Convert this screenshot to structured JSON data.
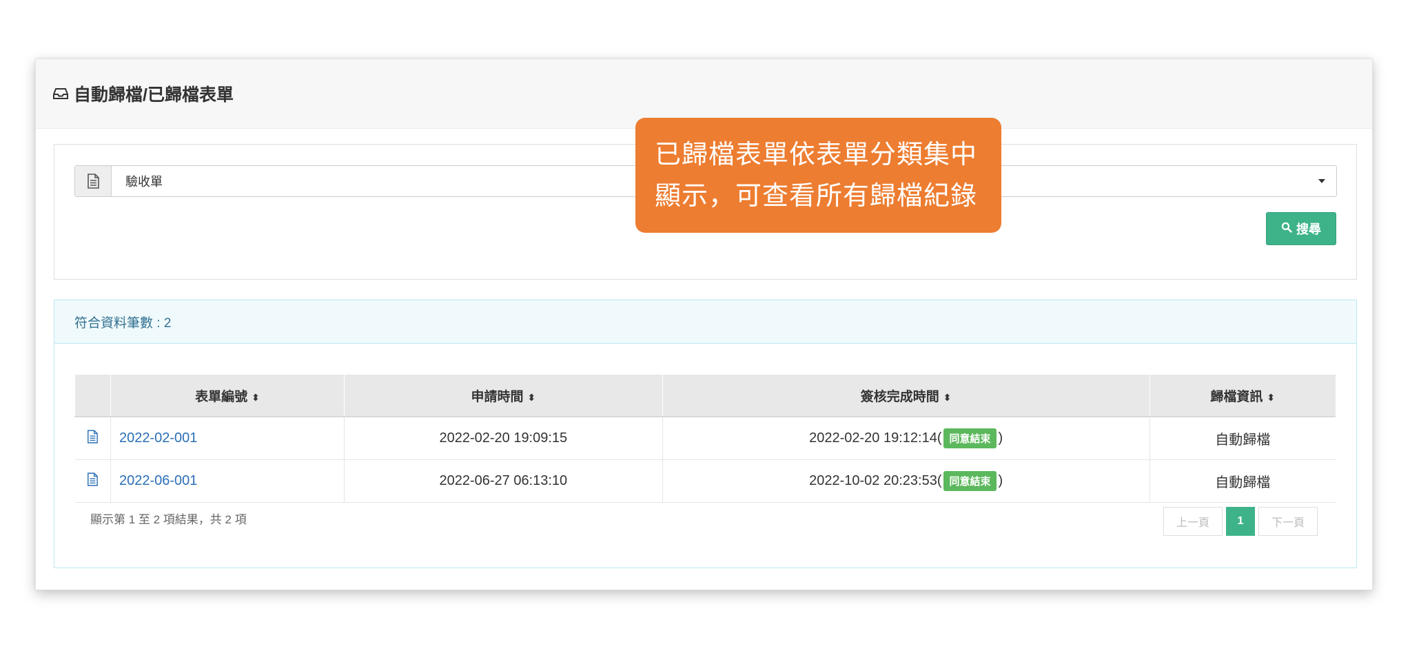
{
  "header": {
    "title": "自動歸檔/已歸檔表單"
  },
  "search": {
    "selected": "驗收單",
    "button_label": "搜尋"
  },
  "result": {
    "count_label": "符合資料筆數 : 2"
  },
  "table": {
    "columns": [
      "表單編號",
      "申請時間",
      "簽核完成時間",
      "歸檔資訊"
    ],
    "rows": [
      {
        "id": "2022-02-001",
        "apply_time": "2022-02-20 19:09:15",
        "complete_time": "2022-02-20 19:12:14(",
        "badge": "同意結束",
        "close": ")",
        "archive": "自動歸檔"
      },
      {
        "id": "2022-06-001",
        "apply_time": "2022-06-27 06:13:10",
        "complete_time": "2022-10-02 20:23:53(",
        "badge": "同意結束",
        "close": ")",
        "archive": "自動歸檔"
      }
    ]
  },
  "footer": {
    "info": "顯示第 1 至 2 項結果，共 2 項"
  },
  "pager": {
    "prev": "上一頁",
    "current": "1",
    "next": "下一頁"
  },
  "callout": {
    "line1": "已歸檔表單依表單分類集中",
    "line2": "顯示，可查看所有歸檔紀錄"
  },
  "colors": {
    "accent": "#3eb38a",
    "link": "#2a6fb6",
    "badge": "#5cb85c",
    "callout": "#ed7d31"
  },
  "icons": [
    "inbox-icon",
    "document-icon",
    "search-icon",
    "sort-icon"
  ]
}
